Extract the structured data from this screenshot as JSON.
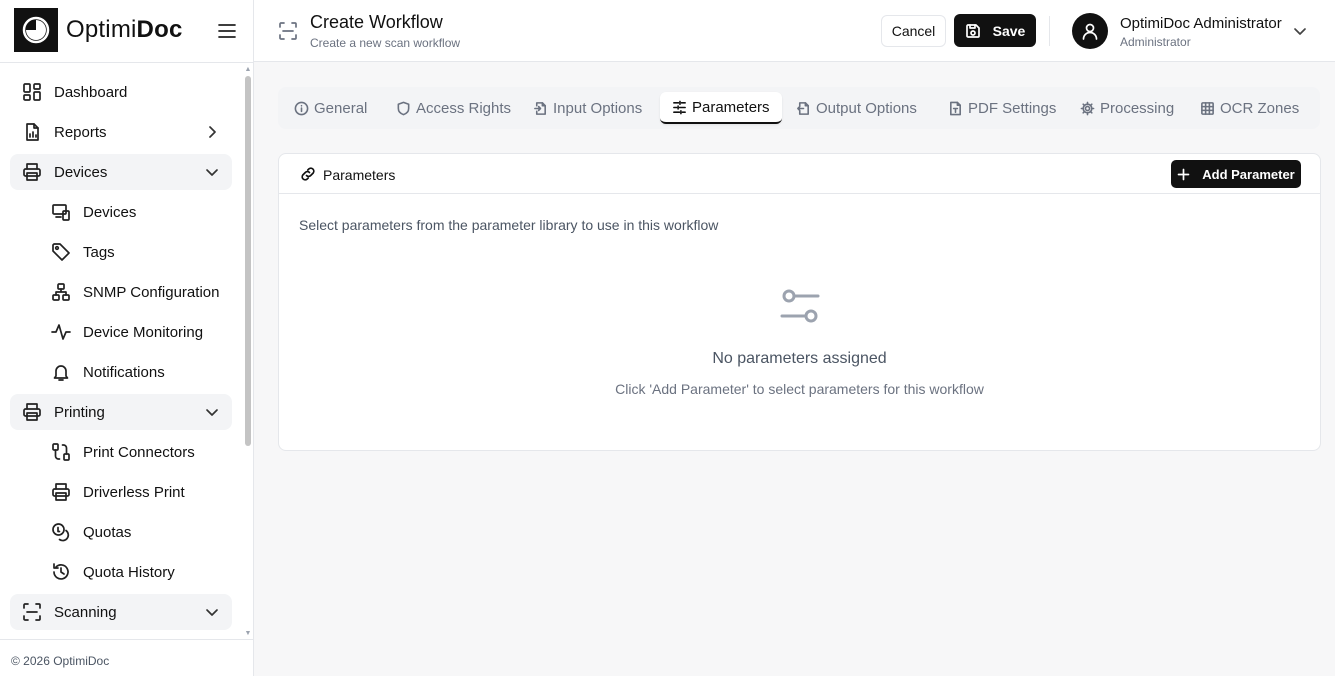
{
  "brand": {
    "name_prefix": "Optimi",
    "name_suffix": "Doc"
  },
  "sidebar": {
    "items": [
      {
        "label": "Dashboard"
      },
      {
        "label": "Reports"
      },
      {
        "label": "Devices"
      },
      {
        "label": "Devices"
      },
      {
        "label": "Tags"
      },
      {
        "label": "SNMP Configuration"
      },
      {
        "label": "Device Monitoring"
      },
      {
        "label": "Notifications"
      },
      {
        "label": "Printing"
      },
      {
        "label": "Print Connectors"
      },
      {
        "label": "Driverless Print"
      },
      {
        "label": "Quotas"
      },
      {
        "label": "Quota History"
      },
      {
        "label": "Scanning"
      }
    ],
    "footer": "© 2026 OptimiDoc"
  },
  "header": {
    "title": "Create Workflow",
    "subtitle": "Create a new scan workflow",
    "cancel_label": "Cancel",
    "save_label": "Save",
    "user_name": "OptimiDoc Administrator",
    "user_role": "Administrator"
  },
  "tabs": [
    {
      "label": "General",
      "icon": "info-icon"
    },
    {
      "label": "Access Rights",
      "icon": "shield-icon"
    },
    {
      "label": "Input Options",
      "icon": "file-import-icon"
    },
    {
      "label": "Parameters",
      "icon": "sliders-icon"
    },
    {
      "label": "Output Options",
      "icon": "file-export-icon"
    },
    {
      "label": "PDF Settings",
      "icon": "file-type-icon"
    },
    {
      "label": "Processing",
      "icon": "gear-icon"
    },
    {
      "label": "OCR Zones",
      "icon": "grid-icon"
    }
  ],
  "card": {
    "title": "Parameters",
    "add_label": "Add Parameter",
    "description": "Select parameters from the parameter library to use in this workflow",
    "empty_title": "No parameters assigned",
    "empty_hint": "Click 'Add Parameter' to select parameters for this workflow"
  },
  "colors": {
    "primary": "#111111",
    "muted": "#6b7280",
    "border": "#e5e7eb",
    "background": "#f7f7f8"
  }
}
